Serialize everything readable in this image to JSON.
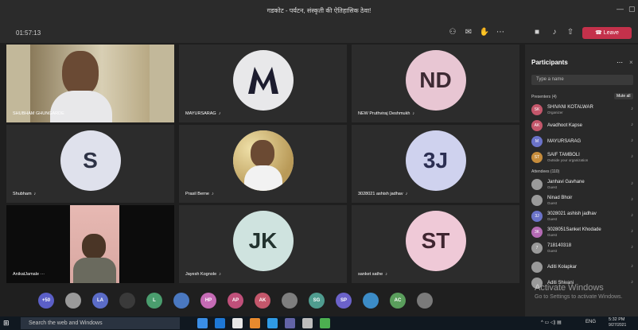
{
  "window": {
    "title": "गडकोट - पर्यटन, संस्कृती की ऐतिहासिक ठेवा!"
  },
  "toolbar": {
    "timer": "01:57:13",
    "leave_label": "Leave"
  },
  "tiles": [
    {
      "name": "SHUBHAM GHUNGARDE",
      "initials": "",
      "type": "video",
      "muted": false
    },
    {
      "name": "MAYURSARAG",
      "initials": "M",
      "type": "logo",
      "muted": true
    },
    {
      "name": "NEW Pruthviraj Deshmukh",
      "initials": "ND",
      "type": "initials",
      "color": "#e8c6d3",
      "muted": true
    },
    {
      "name": "Shubham",
      "initials": "S",
      "type": "initials",
      "color": "#dfe1ec",
      "muted": true
    },
    {
      "name": "Prasil Berne",
      "initials": "",
      "type": "photo",
      "muted": true
    },
    {
      "name": "3028021 ashish jadhav",
      "initials": "3J",
      "type": "initials",
      "color": "#cfd2ee",
      "muted": true
    },
    {
      "name": "AnikatJamale",
      "initials": "",
      "type": "video",
      "muted": false,
      "more": "···"
    },
    {
      "name": "Jayesh Kognole",
      "initials": "JK",
      "type": "initials",
      "color": "#cfe3df",
      "muted": true
    },
    {
      "name": "sanket sathe",
      "initials": "ST",
      "type": "initials",
      "color": "#efc9d7",
      "muted": true
    }
  ],
  "bottom_chips": [
    {
      "label": "+50",
      "color": "#5b5fc7"
    },
    {
      "label": "",
      "color": "#9a9a9a"
    },
    {
      "label": "LA",
      "color": "#5b6cc7"
    },
    {
      "label": "",
      "color": "#3a3a3a"
    },
    {
      "label": "L",
      "color": "#4a9d6e"
    },
    {
      "label": "",
      "color": "#4a78c0"
    },
    {
      "label": "HP",
      "color": "#c56bb5"
    },
    {
      "label": "AP",
      "color": "#c0507a"
    },
    {
      "label": "AK",
      "color": "#c4576b"
    },
    {
      "label": "",
      "color": "#7e7e7e"
    },
    {
      "label": "SG",
      "color": "#4f9c8f"
    },
    {
      "label": "SP",
      "color": "#6b62c9"
    },
    {
      "label": "",
      "color": "#3c8cc7"
    },
    {
      "label": "AC",
      "color": "#5a9e5c"
    },
    {
      "label": "",
      "color": "#7a7a7a"
    }
  ],
  "panel": {
    "title": "Participants",
    "search_placeholder": "Type a name",
    "presenters_label": "Presenters (4)",
    "mute_all_label": "Mute all",
    "attendees_label": "Attendees (110)",
    "presenters": [
      {
        "name": "SHIVANI KOTALWAR",
        "role": "Organizer",
        "initials": "SK",
        "color": "#c4576b"
      },
      {
        "name": "Avadhoot Kapse",
        "role": "",
        "initials": "AK",
        "color": "#c4576b"
      },
      {
        "name": "MAYURSARAG",
        "role": "",
        "initials": "M",
        "color": "#6b73c9"
      },
      {
        "name": "SAIF TAMBOLI",
        "role": "Outside your organization",
        "initials": "ST",
        "color": "#c78d3c"
      }
    ],
    "attendees": [
      {
        "name": "Janhavi Gavhane",
        "role": "Guest",
        "initials": "",
        "color": "#9a9a9a"
      },
      {
        "name": "Ninad Bhoir",
        "role": "Guest",
        "initials": "",
        "color": "#9a9a9a"
      },
      {
        "name": "3028021 ashish jadhav",
        "role": "Guest",
        "initials": "3J",
        "color": "#6b73c9"
      },
      {
        "name": "3028051Sanket Khodade",
        "role": "Guest",
        "initials": "3K",
        "color": "#b56bb5"
      },
      {
        "name": "718140318",
        "role": "Guest",
        "initials": "7",
        "color": "#9a9a9a"
      },
      {
        "name": "Aditi Kolapkar",
        "role": "",
        "initials": "",
        "color": "#9a9a9a"
      },
      {
        "name": "Aditi Shivani",
        "role": "",
        "initials": "",
        "color": "#9a9a9a"
      }
    ]
  },
  "watermark": {
    "line1": "Activate Windows",
    "line2": "Go to Settings to activate Windows."
  },
  "taskbar": {
    "search_placeholder": "Search the web and Windows",
    "lang": "ENG",
    "time": "5:32 PM",
    "date": "9/27/2021"
  }
}
